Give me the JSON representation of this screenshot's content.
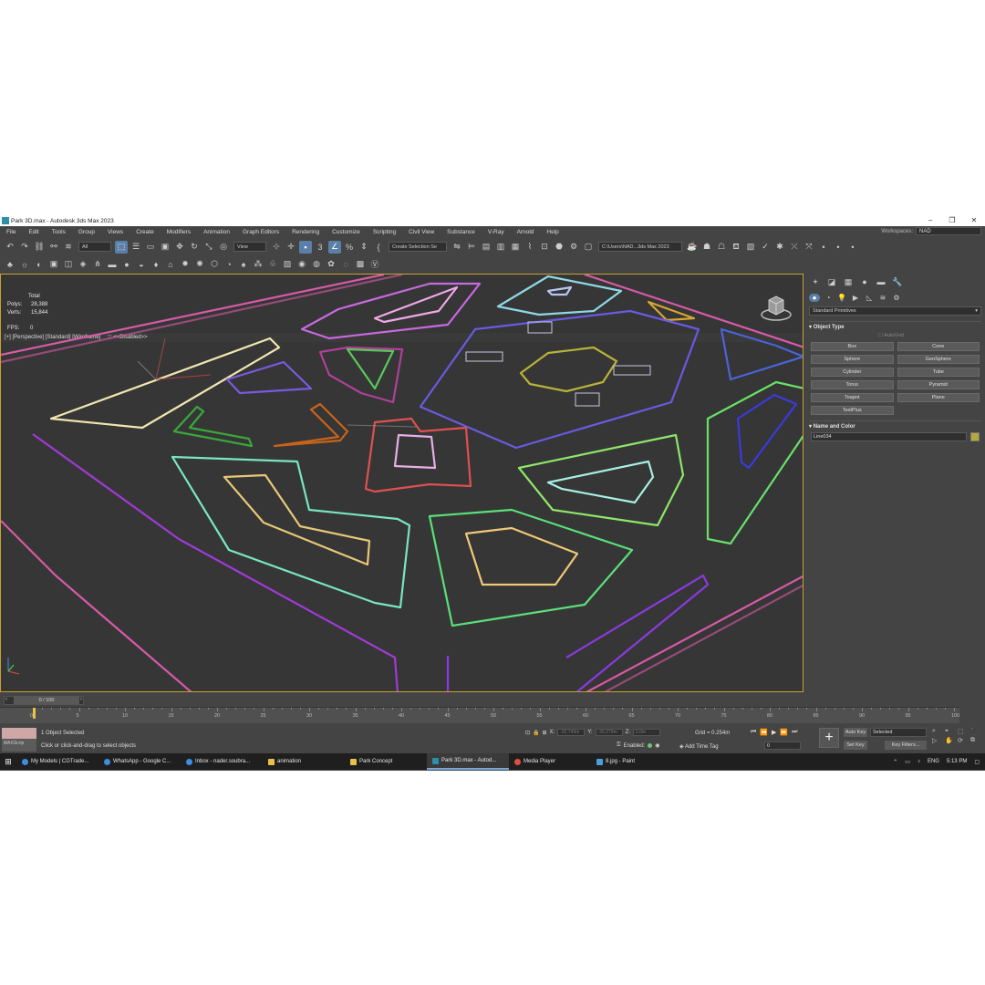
{
  "window": {
    "title": "Park 3D.max - Autodesk 3ds Max 2023",
    "minimize": "–",
    "maximize": "❐",
    "close": "✕"
  },
  "menu": [
    "File",
    "Edit",
    "Tools",
    "Group",
    "Views",
    "Create",
    "Modifiers",
    "Animation",
    "Graph Editors",
    "Rendering",
    "Customize",
    "Scripting",
    "Civil View",
    "Substance",
    "V-Ray",
    "Arnold",
    "Help"
  ],
  "workspaces": {
    "label": "Workspaces:",
    "value": "NAD"
  },
  "toolbar1": {
    "selection_filter": "All",
    "ref_coord": "View",
    "named_selection": "Create Selection Se",
    "project_path": "C:\\Users\\NAD...3ds Max 2023"
  },
  "viewport": {
    "label": "[+] [Perspective] [Standard] [Wireframe]",
    "filter": "<<Disabled>>",
    "stats": {
      "total_label": "Total",
      "polys_label": "Polys:",
      "polys": "28,388",
      "verts_label": "Verts:",
      "verts": "15,844",
      "fps_label": "FPS:",
      "fps": "0"
    }
  },
  "command_panel": {
    "category": "Standard Primitives",
    "object_type_title": "Object Type",
    "autogrid": "AutoGrid",
    "buttons": [
      "Box",
      "Cone",
      "Sphere",
      "GeoSphere",
      "Cylinder",
      "Tube",
      "Torus",
      "Pyramid",
      "Teapot",
      "Plane",
      "TextPlus"
    ],
    "name_color_title": "Name and Color",
    "object_name": "Line034",
    "object_color": "#b7a63a"
  },
  "timeline": {
    "slider": "0 / 100",
    "ticks": [
      "0",
      "5",
      "10",
      "15",
      "20",
      "25",
      "30",
      "35",
      "40",
      "45",
      "50",
      "55",
      "60",
      "65",
      "70",
      "75",
      "80",
      "85",
      "90",
      "95",
      "100"
    ]
  },
  "status": {
    "maxscript": "MAXScrip",
    "selection": "1 Object Selected",
    "prompt": "Click or click-and-drag to select objects",
    "x_label": "X:",
    "x": "-22.743m",
    "y_label": "Y:",
    "y": "-35.279m",
    "z_label": "Z:",
    "z": "0.0m",
    "grid": "Grid = 0.254m",
    "enabled_label": "Enabled:",
    "add_time_tag": "Add Time Tag",
    "frame": "0",
    "auto_key": "Auto Key",
    "set_key": "Set Key",
    "selected": "Selected",
    "key_filters": "Key Filters..."
  },
  "taskbar": {
    "items": [
      {
        "label": "My Models | CGTrade...",
        "color": "#3d8ee0"
      },
      {
        "label": "WhatsApp - Google C...",
        "color": "#3d8ee0"
      },
      {
        "label": "Inbox - nader.soubra...",
        "color": "#3d8ee0"
      },
      {
        "label": "animation",
        "color": "#e8c04a"
      },
      {
        "label": "Park Concept",
        "color": "#e8c04a"
      },
      {
        "label": "Park 3D.max - Autod...",
        "color": "#2d8fa8"
      },
      {
        "label": "Media Player",
        "color": "#e0503d"
      },
      {
        "label": "8.jpg - Paint",
        "color": "#4aa0d8"
      }
    ],
    "lang": "ENG",
    "time": "5:13 PM"
  }
}
